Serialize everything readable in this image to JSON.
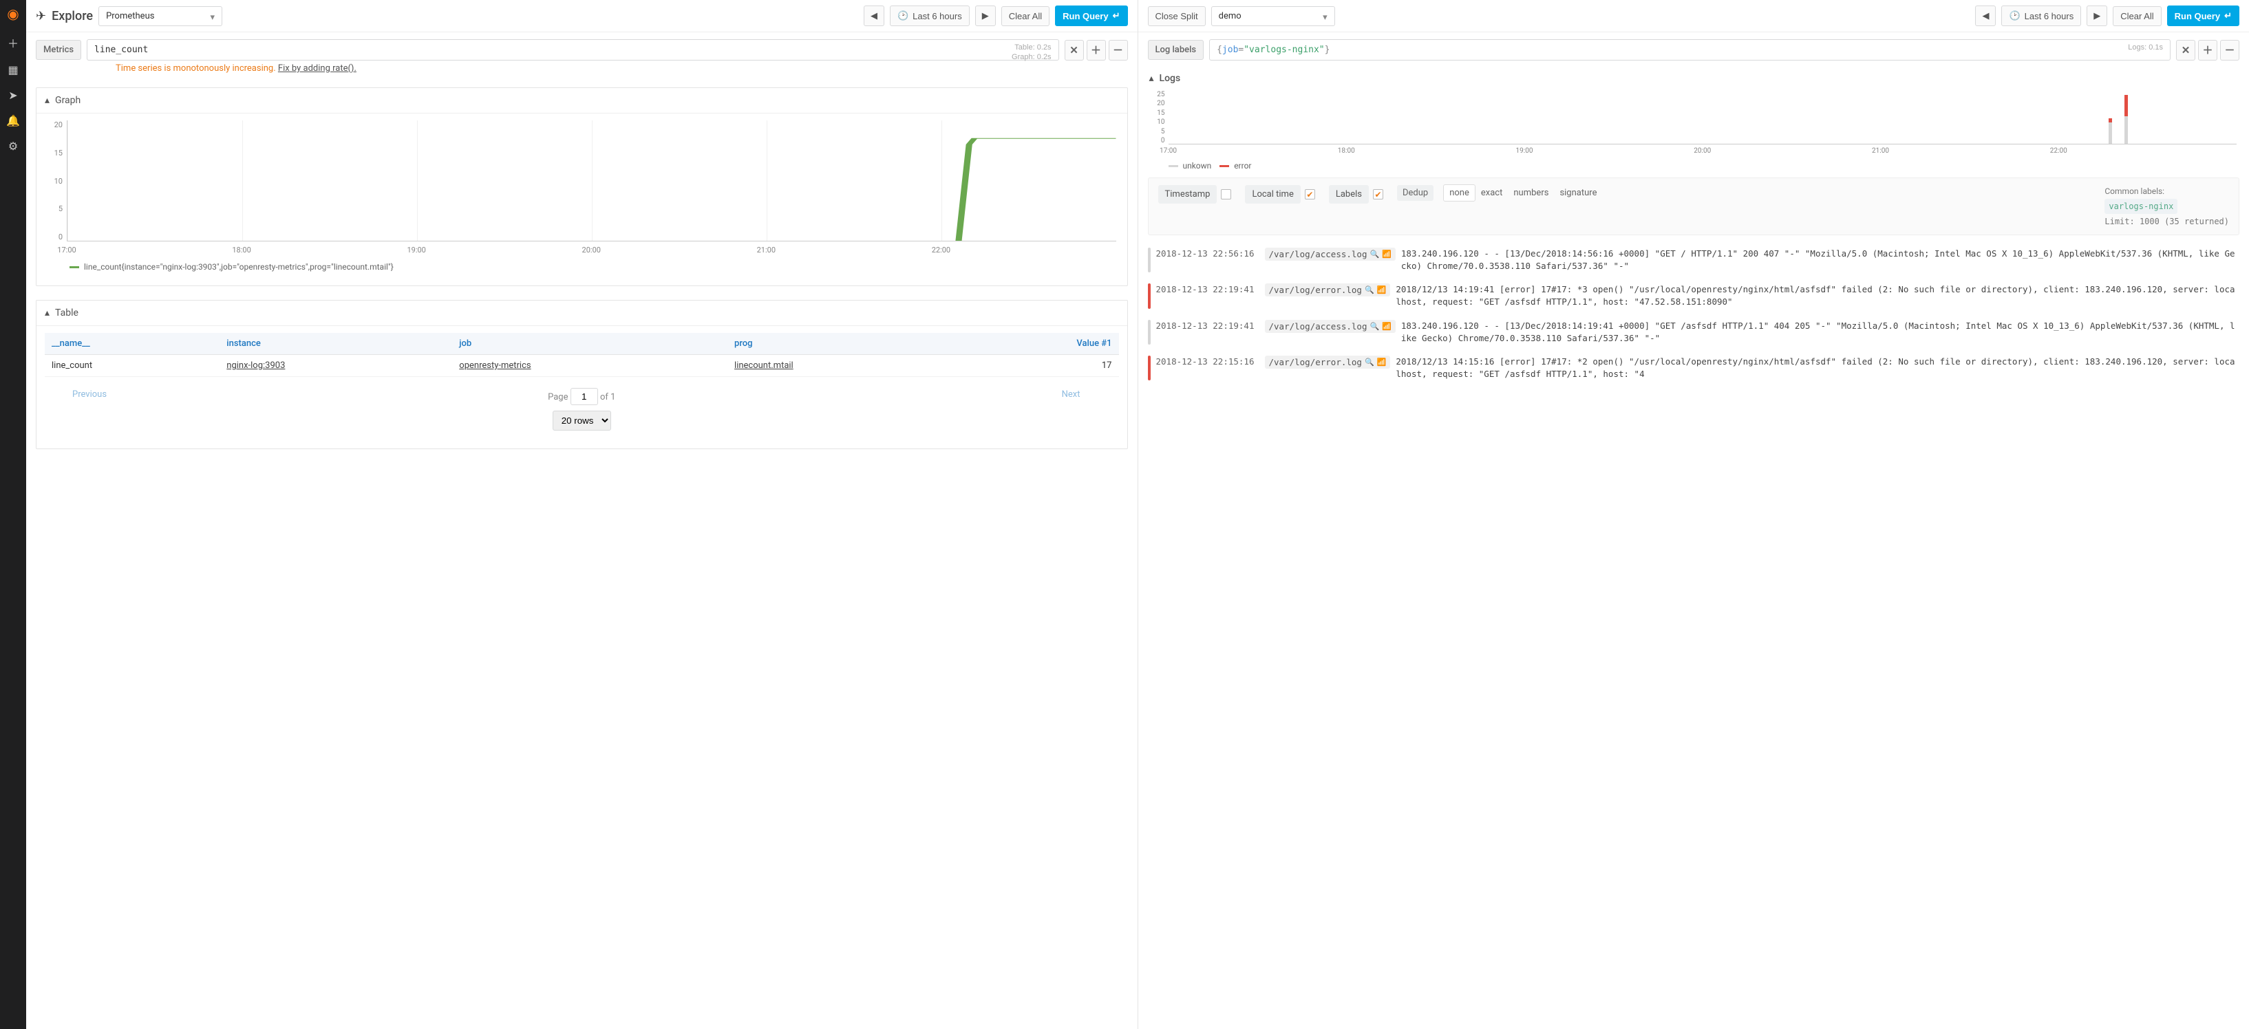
{
  "sidenav": {
    "items": [
      "plus",
      "dashboards",
      "explore",
      "alerts",
      "settings"
    ]
  },
  "left": {
    "title": "Explore",
    "datasource": "Prometheus",
    "timerange_label": "Last 6 hours",
    "clear_label": "Clear All",
    "run_label": "Run Query",
    "query_label": "Metrics",
    "query_text": "line_count",
    "timing_table": "Table: 0.2s",
    "timing_graph": "Graph: 0.2s",
    "hint_warn": "Time series is monotonously increasing.",
    "hint_fix": "Fix by adding rate().",
    "graph": {
      "header": "Graph",
      "y_ticks": [
        "20",
        "15",
        "10",
        "5",
        "0"
      ],
      "x_ticks": [
        "17:00",
        "18:00",
        "19:00",
        "20:00",
        "21:00",
        "22:00"
      ],
      "legend": "line_count{instance=\"nginx-log:3903\",job=\"openresty-metrics\",prog=\"linecount.mtail\"}",
      "series_color": "#6aa84f"
    },
    "table": {
      "header": "Table",
      "columns": [
        "__name__",
        "instance",
        "job",
        "prog",
        "Value #1"
      ],
      "rows": [
        {
          "name": "line_count",
          "instance": "nginx-log:3903",
          "job": "openresty-metrics",
          "prog": "linecount.mtail",
          "value": "17"
        }
      ],
      "pager": {
        "prev": "Previous",
        "next": "Next",
        "page_label": "Page",
        "page": "1",
        "of_label": "of 1",
        "rows_select": "20 rows"
      }
    }
  },
  "right": {
    "close_label": "Close Split",
    "datasource": "demo",
    "timerange_label": "Last 6 hours",
    "clear_label": "Clear All",
    "run_label": "Run Query",
    "query_label": "Log labels",
    "query_key": "job",
    "query_val": "\"varlogs-nginx\"",
    "timing_logs": "Logs: 0.1s",
    "logs_header": "Logs",
    "logchart": {
      "y_ticks": [
        "25",
        "20",
        "15",
        "10",
        "5",
        "0"
      ],
      "x_ticks": [
        "17:00",
        "18:00",
        "19:00",
        "20:00",
        "21:00",
        "22:00"
      ],
      "legend_unknown": "unkown",
      "legend_error": "error"
    },
    "options": {
      "timestamp": "Timestamp",
      "localtime": "Local time",
      "labels": "Labels",
      "dedup": "Dedup",
      "dedup_opts": [
        "none",
        "exact",
        "numbers",
        "signature"
      ],
      "dedup_selected": "none",
      "common_label_hdr": "Common labels:",
      "common_badge": "varlogs-nginx",
      "limit_text": "Limit: 1000 (35 returned)"
    },
    "rows": [
      {
        "level": "info",
        "ts": "2018-12-13 22:56:16",
        "file": "/var/log/access.log",
        "msg": "183.240.196.120 - - [13/Dec/2018:14:56:16 +0000] \"GET / HTTP/1.1\" 200 407 \"-\" \"Mozilla/5.0 (Macintosh; Intel Mac OS X 10_13_6) AppleWebKit/537.36 (KHTML, like Gecko) Chrome/70.0.3538.110 Safari/537.36\" \"-\""
      },
      {
        "level": "error",
        "ts": "2018-12-13 22:19:41",
        "file": "/var/log/error.log",
        "msg": "2018/12/13 14:19:41 [error] 17#17: *3 open() \"/usr/local/openresty/nginx/html/asfsdf\" failed (2: No such file or directory), client: 183.240.196.120, server: localhost, request: \"GET /asfsdf HTTP/1.1\", host: \"47.52.58.151:8090\""
      },
      {
        "level": "info",
        "ts": "2018-12-13 22:19:41",
        "file": "/var/log/access.log",
        "msg": "183.240.196.120 - - [13/Dec/2018:14:19:41 +0000] \"GET /asfsdf HTTP/1.1\" 404 205 \"-\" \"Mozilla/5.0 (Macintosh; Intel Mac OS X 10_13_6) AppleWebKit/537.36 (KHTML, like Gecko) Chrome/70.0.3538.110 Safari/537.36\" \"-\""
      },
      {
        "level": "error",
        "ts": "2018-12-13 22:15:16",
        "file": "/var/log/error.log",
        "msg": "2018/12/13 14:15:16 [error] 17#17: *2 open() \"/usr/local/openresty/nginx/html/asfsdf\" failed (2: No such file or directory), client: 183.240.196.120, server: localhost, request: \"GET /asfsdf HTTP/1.1\", host: \"4"
      }
    ]
  },
  "chart_data": [
    {
      "type": "line",
      "title": "Graph",
      "x_range": [
        "17:00",
        "23:00"
      ],
      "ylim": [
        0,
        20
      ],
      "series": [
        {
          "name": "line_count{instance=\"nginx-log:3903\",job=\"openresty-metrics\",prog=\"linecount.mtail\"}",
          "points": [
            {
              "x": "22:10",
              "y": 0
            },
            {
              "x": "22:12",
              "y": 8
            },
            {
              "x": "22:14",
              "y": 16
            },
            {
              "x": "22:15",
              "y": 17
            },
            {
              "x": "23:00",
              "y": 17
            }
          ]
        }
      ]
    },
    {
      "type": "bar",
      "title": "Logs",
      "x_range": [
        "17:00",
        "23:00"
      ],
      "ylim": [
        0,
        25
      ],
      "series": [
        {
          "name": "unkown",
          "color": "#d6d6d6",
          "points": [
            {
              "x": "22:15",
              "y": 10
            },
            {
              "x": "22:20",
              "y": 13
            }
          ]
        },
        {
          "name": "error",
          "color": "#e24d42",
          "points": [
            {
              "x": "22:15",
              "y": 2
            },
            {
              "x": "22:20",
              "y": 23
            }
          ]
        }
      ]
    }
  ]
}
